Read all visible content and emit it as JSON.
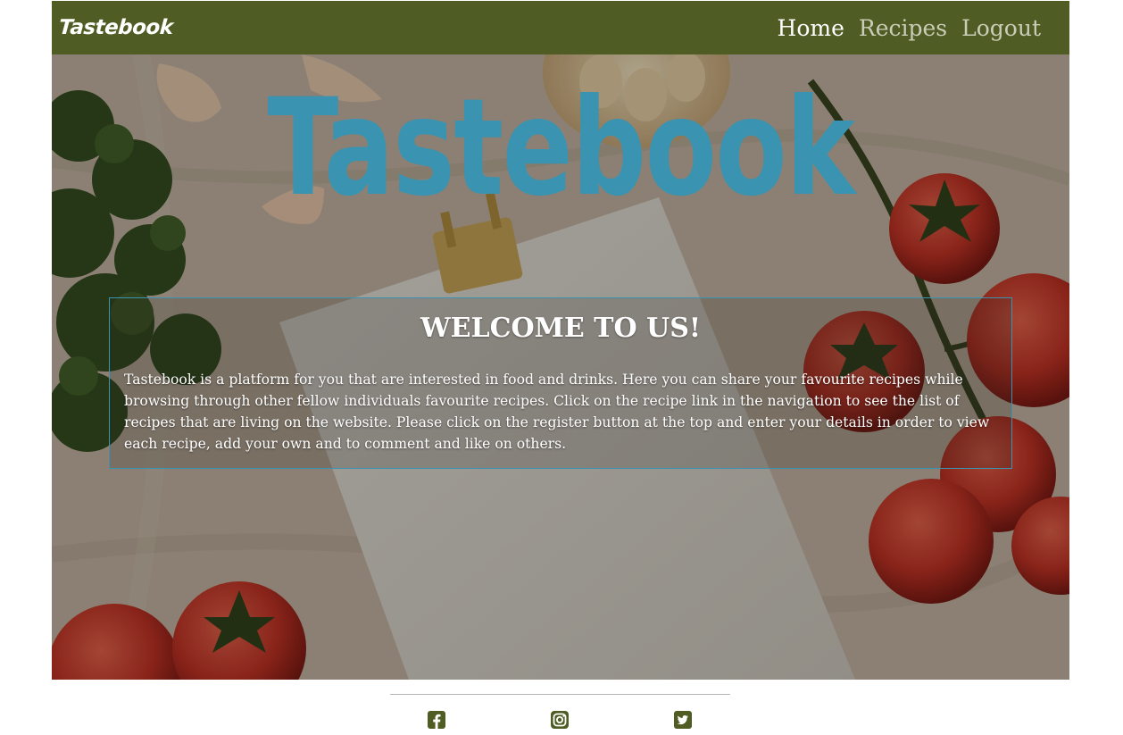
{
  "navbar": {
    "brand": "Tastebook",
    "links": [
      {
        "label": "Home",
        "active": true
      },
      {
        "label": "Recipes",
        "active": false
      },
      {
        "label": "Logout",
        "active": false
      }
    ]
  },
  "hero": {
    "title": "Tastebook",
    "welcome_heading": "WELCOME TO US!",
    "welcome_text": "Tastebook is a platform for you that are interested in food and drinks. Here you can share your favourite recipes while browsing through other fellow individuals favourite recipes. Click on the recipe link in the navigation to see the list of recipes that are living on the website. Please click on the register button at the top and enter your details in order to view each recipe, add your own and to comment and like on others."
  },
  "footer": {
    "icons": [
      "facebook-icon",
      "instagram-icon",
      "twitter-icon"
    ]
  },
  "colors": {
    "navbar": "#4f5d24",
    "accent": "#3a93b0",
    "nav_inactive": "#c9cdb7"
  }
}
